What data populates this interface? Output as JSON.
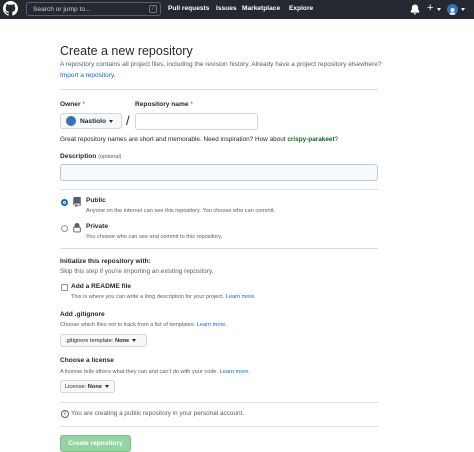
{
  "header": {
    "search_placeholder": "Search or jump to...",
    "search_key": "/",
    "nav": [
      "Pull requests",
      "Issues",
      "Marketplace",
      "Explore"
    ],
    "plus_label": "+",
    "icons": [
      "github-logo-icon",
      "bell-icon",
      "plus-icon",
      "chevron-down-icon",
      "avatar"
    ]
  },
  "page": {
    "title": "Create a new repository",
    "subtitle": "A repository contains all project files, including the revision history. Already have a project repository elsewhere?",
    "import_link": "Import a repository."
  },
  "owner": {
    "label": "Owner",
    "required": "*",
    "value": "Nastiolo"
  },
  "repo_name": {
    "label": "Repository name",
    "required": "*",
    "value": "",
    "slash": "/"
  },
  "name_help": {
    "prefix": "Great repository names are short and memorable. Need inspiration? How about ",
    "suggestion": "crispy-parakeet",
    "suffix": "?"
  },
  "description": {
    "label": "Description",
    "optional": "(optional)",
    "value": ""
  },
  "visibility": {
    "selected": "public",
    "options": [
      {
        "title": "Public",
        "desc": "Anyone on the internet can see this repository. You choose who can commit."
      },
      {
        "title": "Private",
        "desc": "You choose who can see and commit to this repository."
      }
    ]
  },
  "initialize": {
    "title": "Initialize this repository with:",
    "desc": "Skip this step if you're importing an existing repository.",
    "readme_label": "Add a README file",
    "readme_checked": false,
    "readme_desc": "This is where you can write a long description for your project.",
    "learn_more": "Learn more."
  },
  "gitignore": {
    "title": "Add .gitignore",
    "desc": "Choose which files not to track from a list of templates.",
    "learn_more": "Learn more.",
    "button_prefix": ".gitignore template:",
    "button_value": "None"
  },
  "license": {
    "title": "Choose a license",
    "desc": "A license tells others what they can and can't do with your code.",
    "learn_more": "Learn more.",
    "button_prefix": "License:",
    "button_value": "None"
  },
  "notice": {
    "text": "You are creating a public repository in your personal account."
  },
  "submit": {
    "label": "Create repository"
  },
  "colors": {
    "header_bg": "#24292f",
    "link": "#0969da",
    "suggestion": "#116329",
    "required": "#cf222e",
    "button_disabled": "#94d3a2"
  }
}
